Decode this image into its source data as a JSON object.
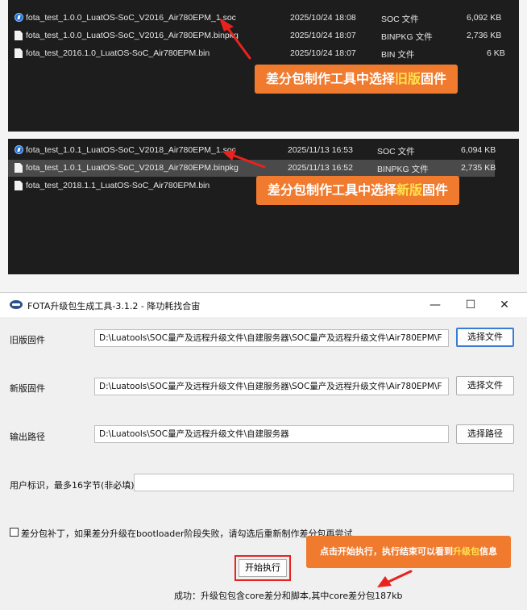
{
  "old_panel": {
    "rows": [
      {
        "icon": "soc",
        "name": "fota_test_1.0.0_LuatOS-SoC_V2016_Air780EPM_1.soc",
        "date": "2025/10/24 18:08",
        "type": "SOC 文件",
        "size": "6,092 KB"
      },
      {
        "icon": "doc",
        "name": "fota_test_1.0.0_LuatOS-SoC_V2016_Air780EPM.binpkg",
        "date": "2025/10/24 18:07",
        "type": "BINPKG 文件",
        "size": "2,736 KB"
      },
      {
        "icon": "doc",
        "name": "fota_test_2016.1.0_LuatOS-SoC_Air780EPM.bin",
        "date": "2025/10/24 18:07",
        "type": "BIN 文件",
        "size": "6 KB"
      }
    ],
    "callout": {
      "prefix": "差分包制作工具中选择",
      "highlight": "旧版",
      "suffix": "固件"
    }
  },
  "new_panel": {
    "rows": [
      {
        "icon": "soc",
        "name": "fota_test_1.0.1_LuatOS-SoC_V2018_Air780EPM_1.soc",
        "date": "2025/11/13 16:53",
        "type": "SOC 文件",
        "size": "6,094 KB"
      },
      {
        "icon": "doc",
        "name": "fota_test_1.0.1_LuatOS-SoC_V2018_Air780EPM.binpkg",
        "date": "2025/11/13 16:52",
        "type": "BINPKG 文件",
        "size": "2,735 KB"
      },
      {
        "icon": "doc",
        "name": "fota_test_2018.1.1_LuatOS-SoC_Air780EPM.bin",
        "date": "",
        "type": "",
        "size": ""
      }
    ],
    "callout": {
      "prefix": "差分包制作工具中选择",
      "highlight": "新版",
      "suffix": "固件"
    }
  },
  "window": {
    "title": "FOTA升级包生成工具-3.1.2 - 降功耗找合宙",
    "minimize": "—",
    "maximize": "☐",
    "close": "✕",
    "old_fw_label": "旧版固件",
    "old_fw_path": "D:\\Luatools\\SOC量产及远程升级文件\\自建服务器\\SOC量产及远程升级文件\\Air780EPM\\F",
    "old_fw_button": "选择文件",
    "new_fw_label": "新版固件",
    "new_fw_path": "D:\\Luatools\\SOC量产及远程升级文件\\自建服务器\\SOC量产及远程升级文件\\Air780EPM\\F",
    "new_fw_button": "选择文件",
    "output_label": "输出路径",
    "output_path": "D:\\Luatools\\SOC量产及远程升级文件\\自建服务器",
    "output_button": "选择路径",
    "user_id_label": "用户标识，最多16字节(非必填)",
    "user_id_value": "",
    "patch_checkbox_label": "差分包补丁，如果差分升级在bootloader阶段失败，请勾选后重新制作差分包再尝试",
    "start_button": "开始执行",
    "status_text": "成功：升级包包含core差分和脚本,其中core差分包187kb",
    "callout": {
      "prefix": "点击开始执行，执行结束可以看到",
      "highlight": "升级包",
      "suffix": "信息"
    }
  },
  "colors": {
    "accent": "#f07a2e",
    "highlight": "#ffe14d",
    "arrow": "#e8231f"
  }
}
